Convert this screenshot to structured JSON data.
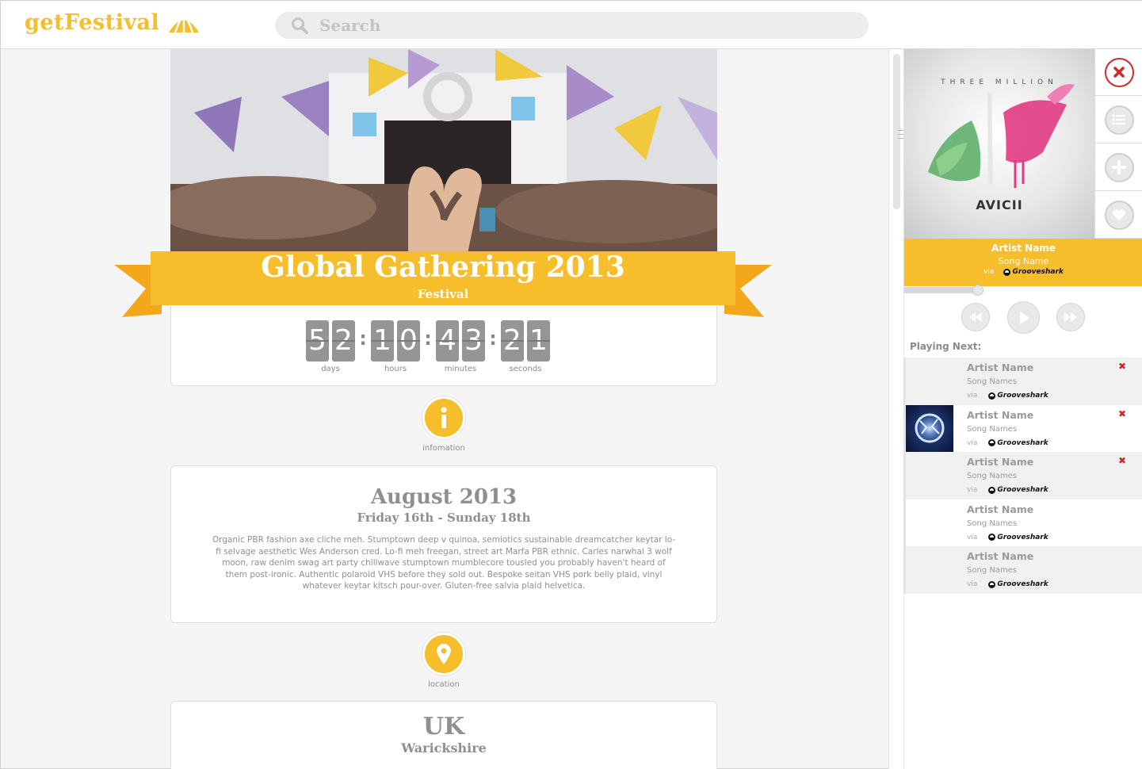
{
  "header": {
    "logo_text": "getFestival",
    "search_placeholder": "Search"
  },
  "event": {
    "title": "Global Gathering 2013",
    "subtitle": "Festival"
  },
  "countdown": [
    {
      "digits": [
        "5",
        "2"
      ],
      "label": "days"
    },
    {
      "digits": [
        "1",
        "0"
      ],
      "label": "hours"
    },
    {
      "digits": [
        "4",
        "3"
      ],
      "label": "minutes"
    },
    {
      "digits": [
        "2",
        "1"
      ],
      "label": "seconds"
    }
  ],
  "information": {
    "icon_label": "infomation",
    "title": "August 2013",
    "dates": "Friday 16th - Sunday 18th",
    "body": "Organic PBR fashion axe cliche meh. Stumptown deep v quinoa, semiotics sustainable dreamcatcher keytar lo-fi selvage aesthetic Wes Anderson cred. Lo-fi meh freegan, street art Marfa PBR ethnic. Carles narwhal 3 wolf moon, raw denim swag art party chillwave stumptown mumblecore tousled you probably haven't heard of them post-ironic. Authentic polaroid VHS before they sold out. Bespoke seitan VHS pork belly plaid, vinyl whatever keytar kitsch pour-over. Gluten-free salvia plaid helvetica."
  },
  "location": {
    "icon_label": "location",
    "country": "UK",
    "region": "Warickshire"
  },
  "player": {
    "album_art_band": "THREE MILLION",
    "album_art_artist": "AVICII",
    "now_playing": {
      "artist": "Artist Name",
      "song": "Song Name",
      "via": "via",
      "source": "Grooveshark"
    },
    "progress": 0.31,
    "playing_next_label": "Playing Next:",
    "queue": [
      {
        "artist": "Artist Name",
        "song": "Song Names",
        "via": "via",
        "source": "Grooveshark",
        "remove": "✖",
        "has_art": false
      },
      {
        "artist": "Artist Name",
        "song": "Song Names",
        "via": "via",
        "source": "Grooveshark",
        "remove": "✖",
        "has_art": true
      },
      {
        "artist": "Artist Name",
        "song": "Song Names",
        "via": "via",
        "source": "Grooveshark",
        "remove": "✖",
        "has_art": false
      },
      {
        "artist": "Artist Name",
        "song": "Song Names",
        "via": "via",
        "source": "Grooveshark",
        "remove": "",
        "has_art": false
      },
      {
        "artist": "Artist Name",
        "song": "Song Names",
        "via": "via",
        "source": "Grooveshark",
        "remove": "",
        "has_art": false
      }
    ]
  },
  "colors": {
    "accent": "#f7be2b",
    "accent_dark": "#e0a21c",
    "close_red": "#cf2a2a",
    "text_gray": "#8f8f8f"
  }
}
